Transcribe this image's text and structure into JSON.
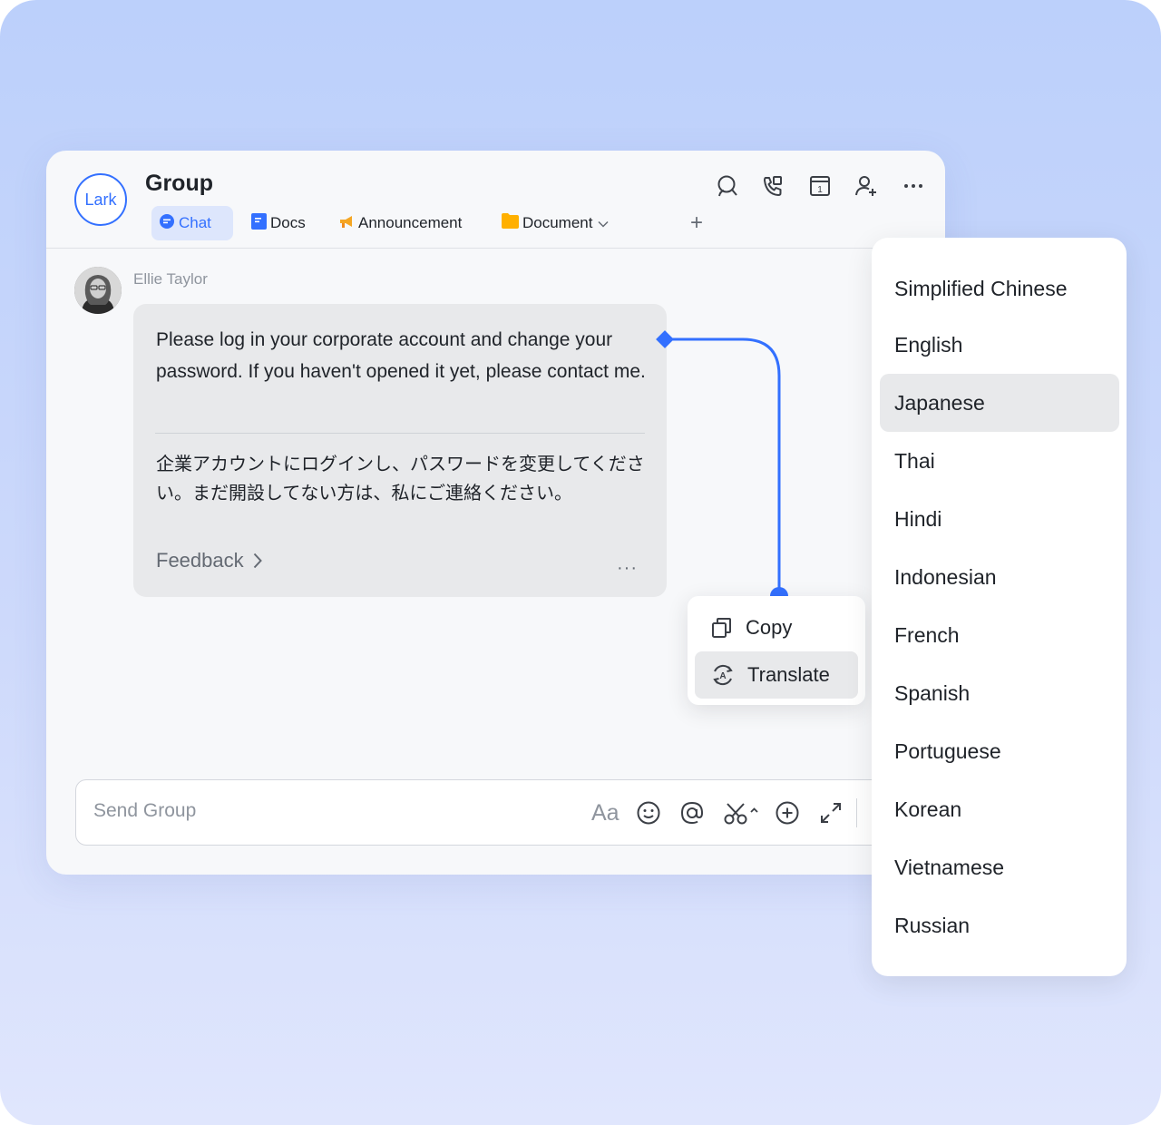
{
  "brand": {
    "logo_text": "Lark",
    "accent": "#3370ff"
  },
  "header": {
    "title": "Group",
    "tabs": [
      {
        "label": "Chat",
        "icon": "chat-icon",
        "active": true
      },
      {
        "label": "Docs",
        "icon": "docs-icon",
        "active": false
      },
      {
        "label": "Announcement",
        "icon": "megaphone-icon",
        "active": false
      },
      {
        "label": "Document",
        "icon": "folder-icon",
        "active": false
      }
    ],
    "add_tab": "+",
    "actions": [
      "search-icon",
      "call-icon",
      "calendar-icon",
      "add-member-icon",
      "more-icon"
    ],
    "calendar_day": "1"
  },
  "message": {
    "sender": "Ellie Taylor",
    "text": "Please log in your corporate account and change your password. If you haven't opened it yet, please contact me.",
    "translation": "企業アカウントにログインし、パスワードを変更してください。まだ開設してない方は、私にご連絡ください。",
    "feedback_label": "Feedback",
    "more": "···"
  },
  "composer": {
    "placeholder": "Send Group",
    "format_label": "Aa",
    "tools": [
      "emoji-icon",
      "mention-icon",
      "screenshot-icon",
      "add-icon",
      "expand-icon"
    ]
  },
  "context_menu": {
    "items": [
      {
        "label": "Copy",
        "icon": "copy-icon",
        "active": false
      },
      {
        "label": "Translate",
        "icon": "translate-icon",
        "active": true
      }
    ]
  },
  "language_menu": {
    "selected": "Japanese",
    "items": [
      "Simplified Chinese",
      "English",
      "Japanese",
      "Thai",
      "Hindi",
      "Indonesian",
      "French",
      "Spanish",
      "Portuguese",
      "Korean",
      "Vietnamese",
      "Russian"
    ]
  }
}
